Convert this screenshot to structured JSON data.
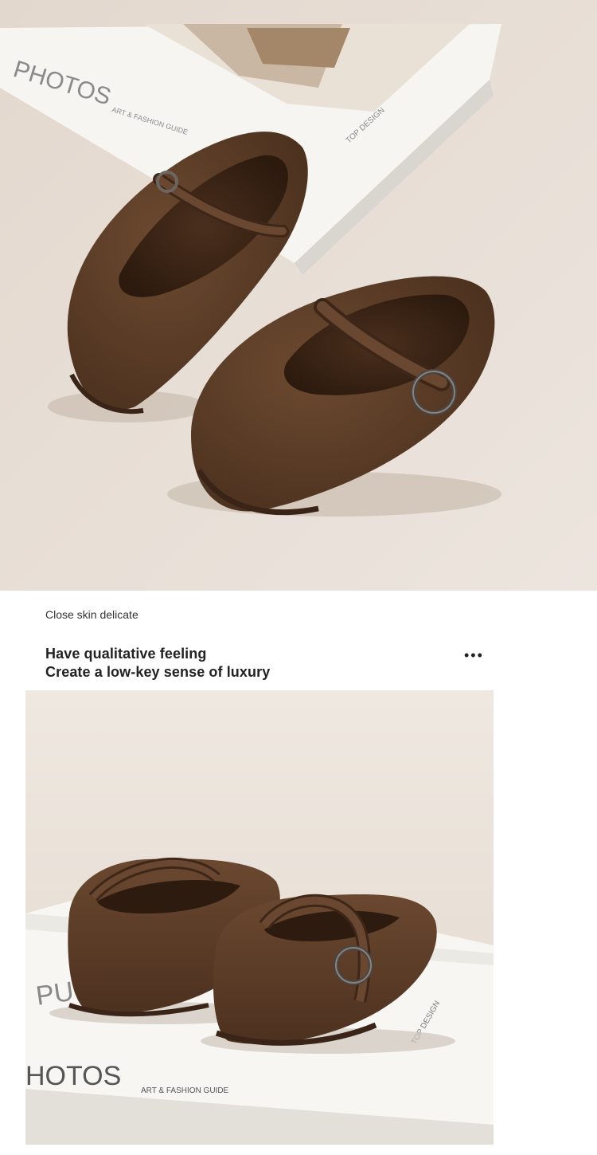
{
  "photo_top": {
    "book_title": "PHOTOS",
    "book_subtitle": "ART & FASHION GUIDE",
    "book_spine": "TOP DESIGN"
  },
  "caption": {
    "label": "Close skin delicate",
    "headline_line1": "Have qualitative feeling",
    "headline_line2": "Create a low-key sense of luxury",
    "more_icon": "•••"
  },
  "photo_bottom": {
    "book_title": "HOTOS",
    "book_subtitle": "ART & FASHION GUIDE",
    "book_spine": "TOP DESIGN",
    "book_letters": "PU"
  },
  "colors": {
    "suede": "#5a3b25",
    "suede_dark": "#3e2718",
    "background_top": "#e6ddd4",
    "background_bottom": "#e9e2d9",
    "book": "#f7f6f3"
  }
}
